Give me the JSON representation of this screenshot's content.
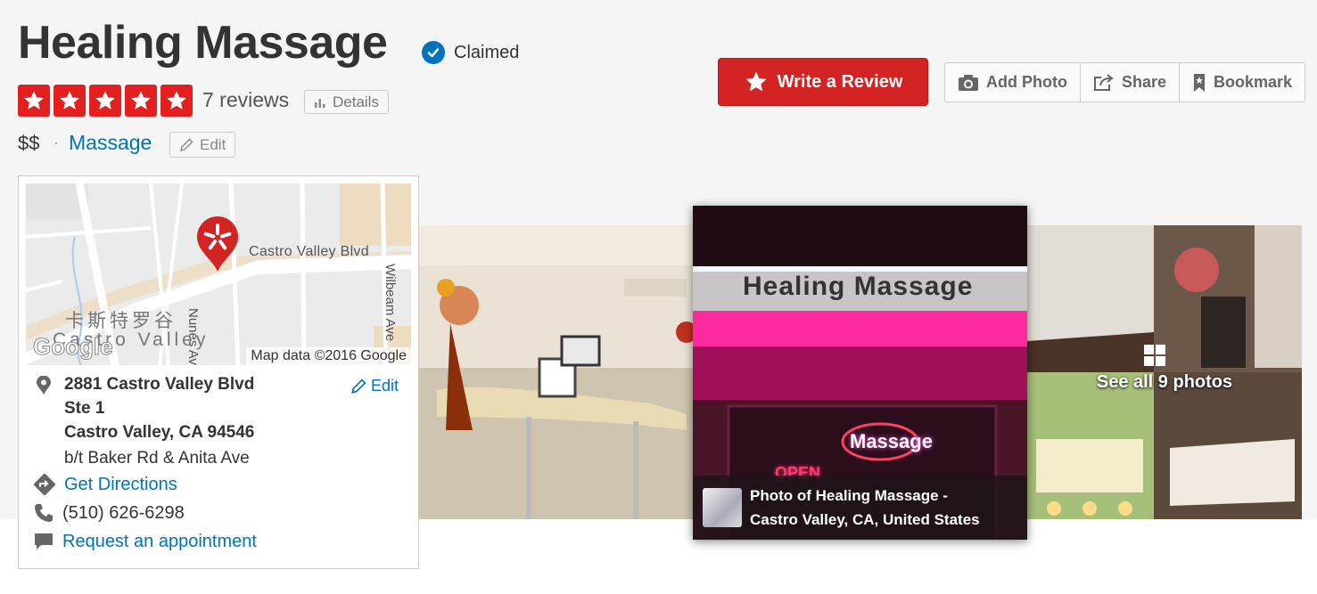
{
  "business": {
    "name": "Healing Massage",
    "claimed_label": "Claimed",
    "rating_stars": 5,
    "reviews_label": "7 reviews",
    "details_label": "Details",
    "price": "$$",
    "separator": "·",
    "category": "Massage",
    "edit_label": "Edit"
  },
  "actions": {
    "write_review": "Write a Review",
    "add_photo": "Add Photo",
    "share": "Share",
    "bookmark": "Bookmark"
  },
  "map": {
    "street_main": "Castro Valley Blvd",
    "street_nunes": "Nunes Ave",
    "street_wilbeam": "Wilbeam Ave",
    "city_chinese": "卡斯特罗谷",
    "city_english": "Castro Valley",
    "google_logo": "Google",
    "credit": "Map data ©2016 Google"
  },
  "address": {
    "line1": "2881 Castro Valley Blvd",
    "line2": "Ste 1",
    "line3": "Castro Valley, CA 94546",
    "cross_streets": "b/t Baker Rd & Anita Ave",
    "edit_label": "Edit"
  },
  "contact": {
    "directions": "Get Directions",
    "phone": "(510) 626-6298",
    "appointment": "Request an appointment"
  },
  "photos": {
    "caption_line1": "Photo of Healing Massage -",
    "caption_line2": "Castro Valley, CA, United States",
    "see_all": "See all 9 photos",
    "sign_text": "Healing Massage",
    "neon_text": "Massage",
    "open_text": "OPEN"
  },
  "colors": {
    "brand_red": "#d32323",
    "star_red": "#e41f1f",
    "link_blue": "#0073bb"
  }
}
